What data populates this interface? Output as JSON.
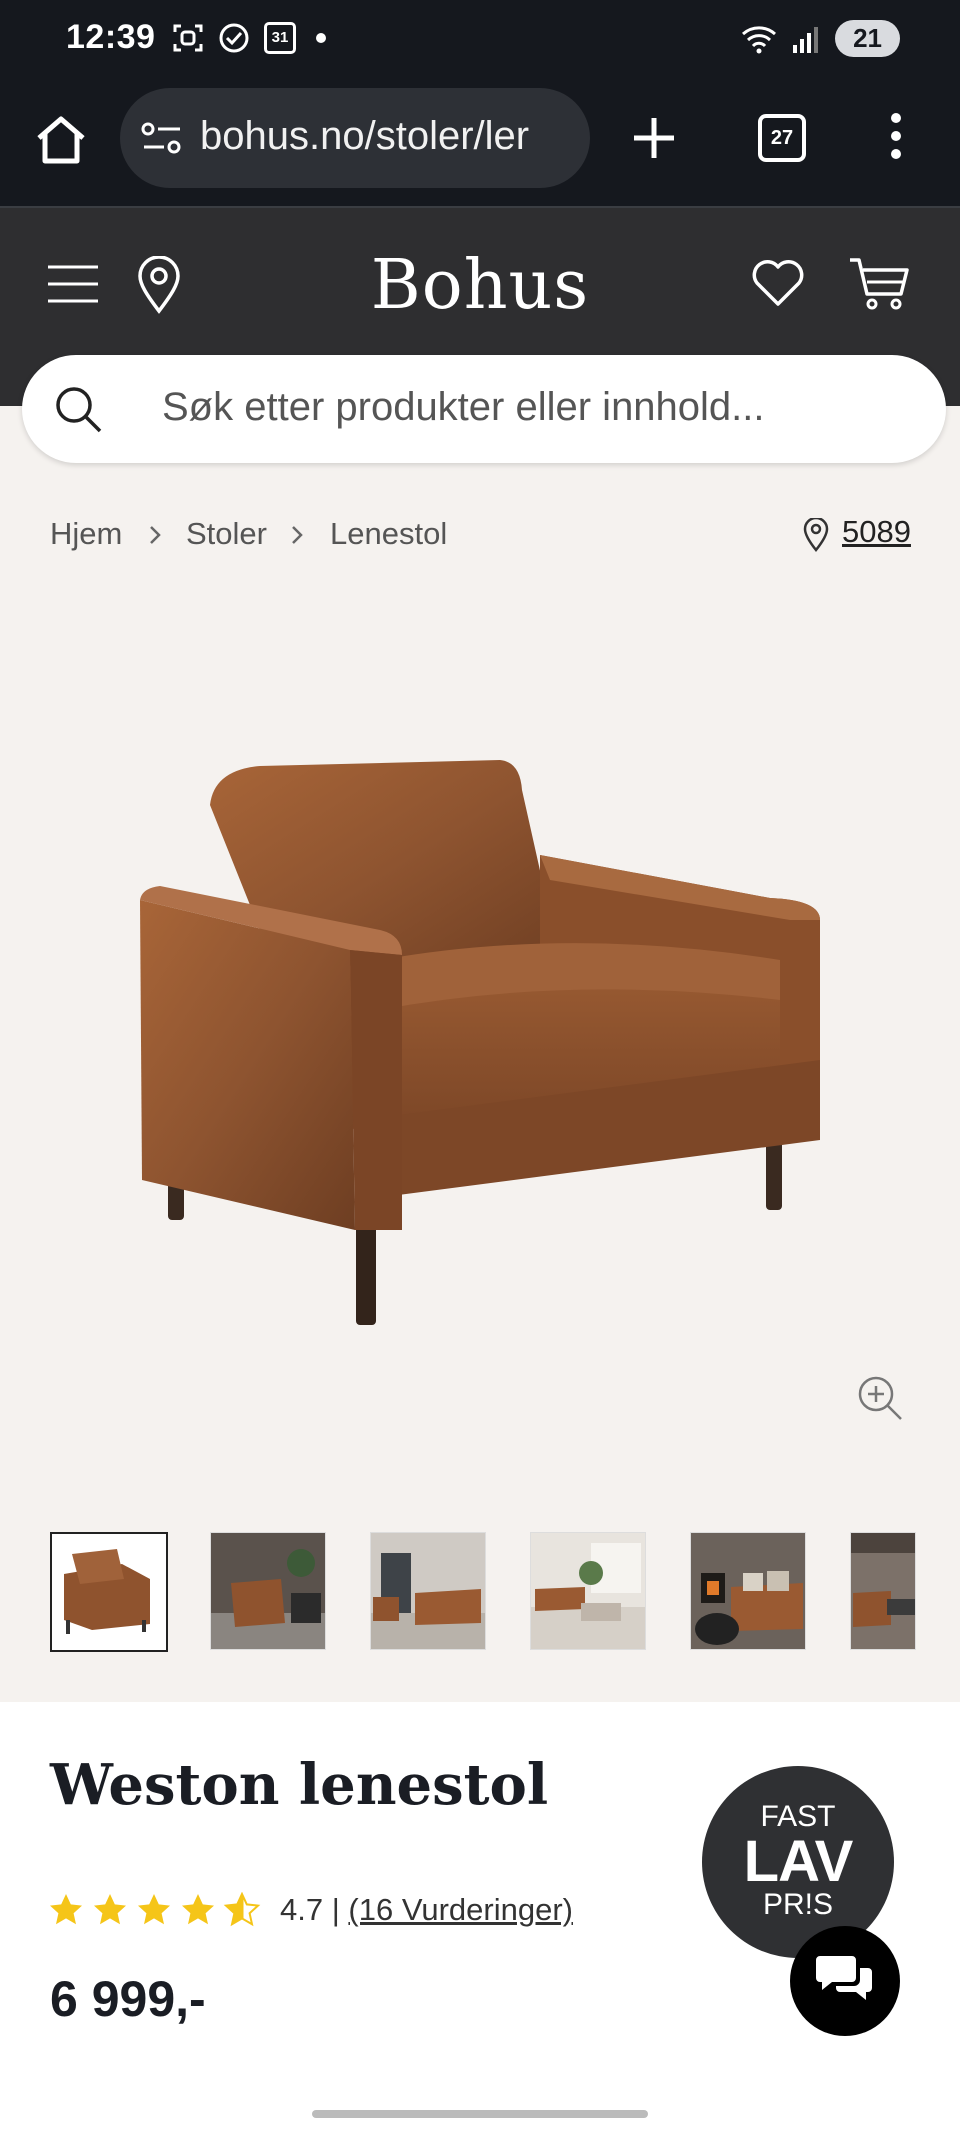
{
  "status": {
    "time": "12:39",
    "calendar_day": "31",
    "battery": "21"
  },
  "browser": {
    "url": "bohus.no/stoler/ler",
    "tab_count": "27"
  },
  "site": {
    "logo": "Bohus",
    "search_placeholder": "Søk etter produkter eller innhold..."
  },
  "breadcrumb": {
    "items": [
      "Hjem",
      "Stoler",
      "Lenestol"
    ],
    "store_number": "5089"
  },
  "product": {
    "title": "Weston lenestol",
    "rating_value": "4.7",
    "rating_separator": "|",
    "rating_count_link": "(16 Vurderinger)",
    "rating_stars": 4.7,
    "price": "6 999,-",
    "badge": {
      "line1": "FAST",
      "line2": "LAV",
      "line3": "PR!S"
    },
    "thumbnail_count": 6
  },
  "colors": {
    "status_bg": "#15181e",
    "header_bg": "#2e2e30",
    "page_bg": "#f5f2ef",
    "star": "#f5c518",
    "leather": "#9a5a32"
  }
}
